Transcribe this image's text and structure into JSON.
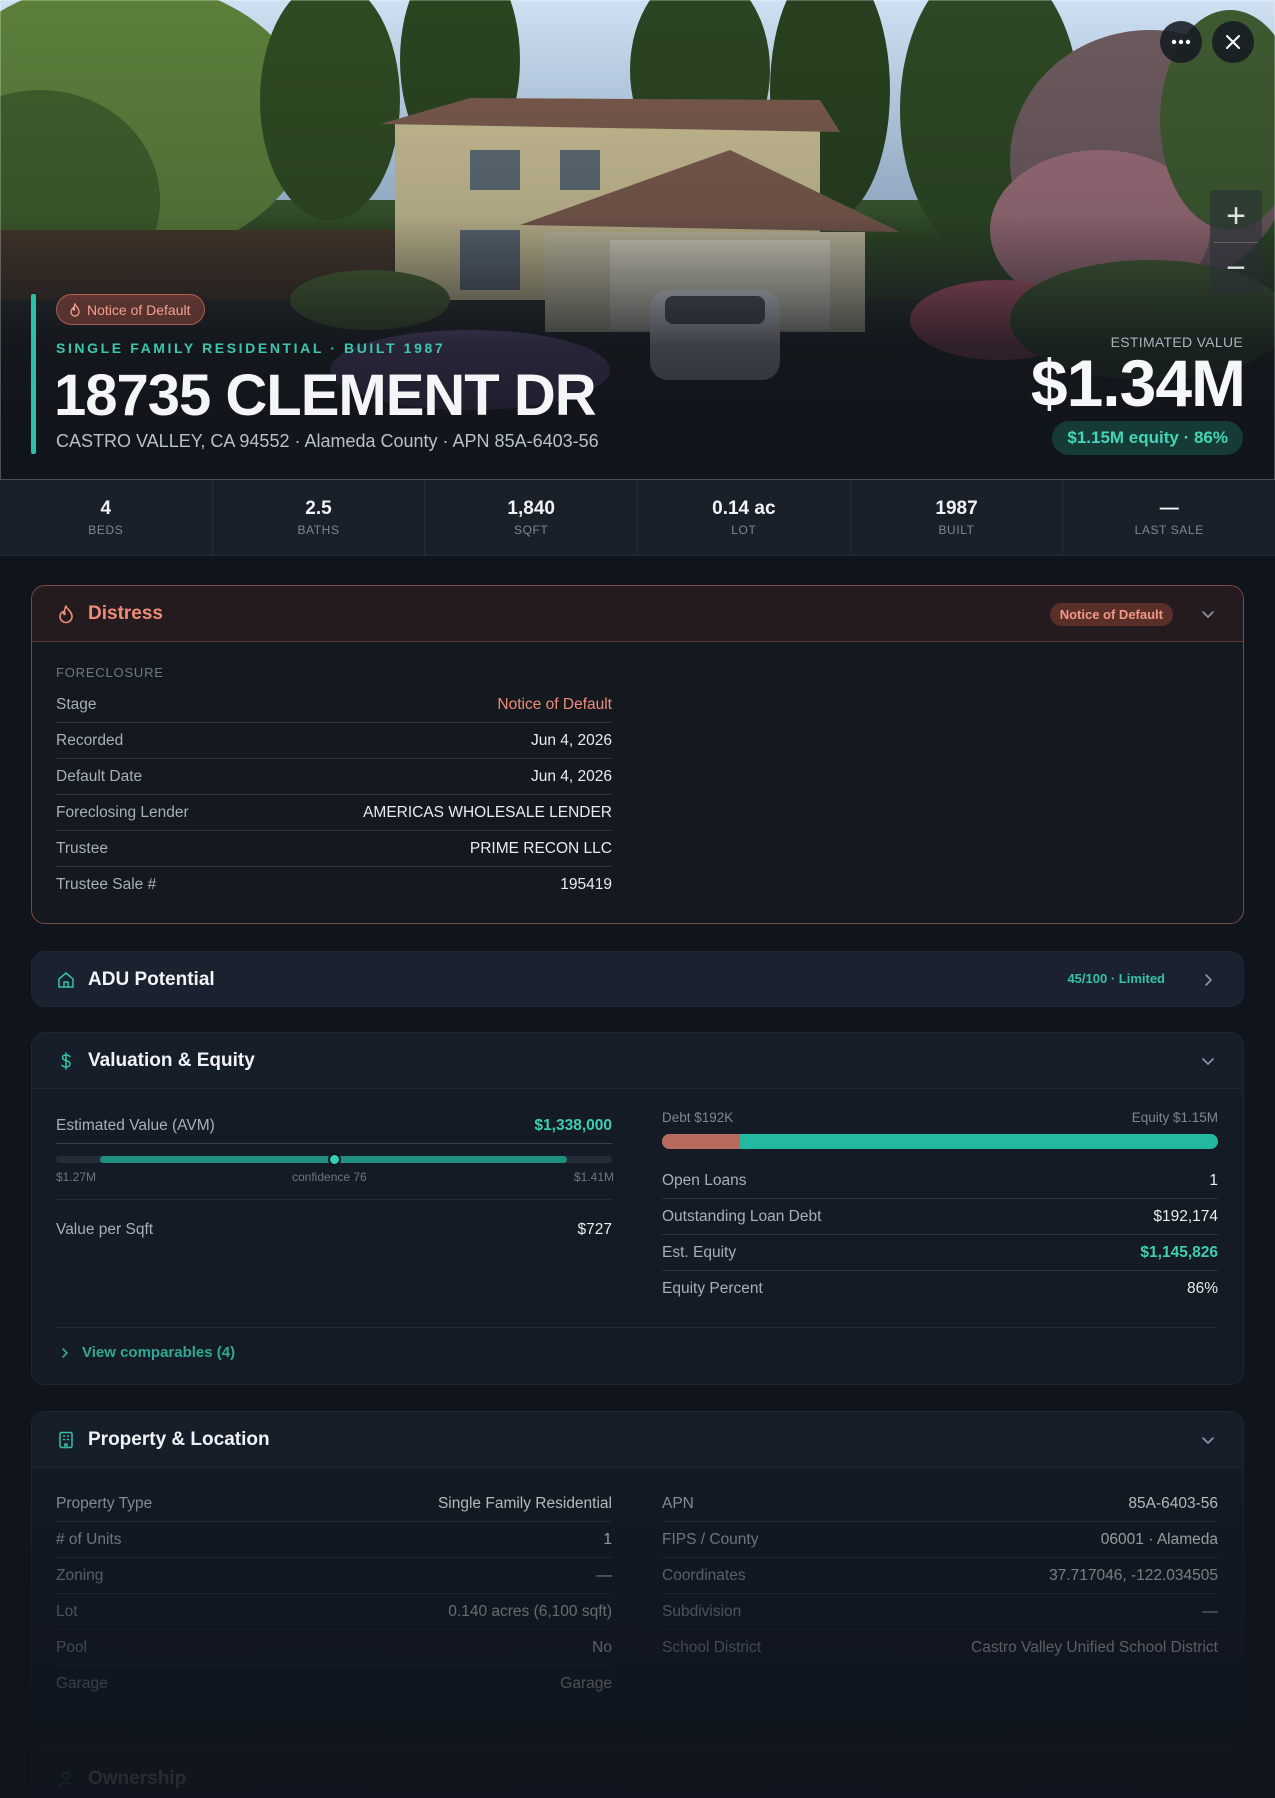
{
  "hero": {
    "distress_badge": "Notice of Default",
    "property_subtitle": "SINGLE FAMILY RESIDENTIAL · BUILT 1987",
    "address": "18735 CLEMENT DR",
    "city_line": "CASTRO VALLEY, CA 94552 · Alameda County · APN 85A-6403-56",
    "estimated_value_label": "ESTIMATED VALUE",
    "estimated_value": "$1.34M",
    "equity_badge": "$1.15M equity · 86%",
    "controls": {
      "more_icon": "more-horizontal-icon",
      "close_icon": "close-icon",
      "zoom_in": "+",
      "zoom_out": "−"
    }
  },
  "stats": [
    {
      "value": "4",
      "label": "BEDS"
    },
    {
      "value": "2.5",
      "label": "BATHS"
    },
    {
      "value": "1,840",
      "label": "SQFT"
    },
    {
      "value": "0.14 ac",
      "label": "LOT"
    },
    {
      "value": "1987",
      "label": "BUILT"
    },
    {
      "value": "—",
      "label": "LAST SALE"
    }
  ],
  "distress": {
    "title": "Distress",
    "badge": "Notice of Default",
    "section_label": "FORECLOSURE",
    "rows": [
      {
        "label": "Stage",
        "value": "Notice of Default"
      },
      {
        "label": "Recorded",
        "value": "Jun 4, 2026"
      },
      {
        "label": "Default Date",
        "value": "Jun 4, 2026"
      },
      {
        "label": "Foreclosing Lender",
        "value": "AMERICAS WHOLESALE LENDER"
      },
      {
        "label": "Trustee",
        "value": "PRIME RECON LLC"
      },
      {
        "label": "Trustee Sale #",
        "value": "195419"
      }
    ]
  },
  "adu": {
    "title": "ADU Potential",
    "score": "45/100 · Limited"
  },
  "valuation": {
    "title": "Valuation & Equity",
    "avm_label": "Estimated Value (AVM)",
    "avm_value": "$1,338,000",
    "range_low": "$1.27M",
    "range_high": "$1.41M",
    "confidence_label": "confidence 76",
    "estimate_position": 0.5,
    "value_per_sqft_label": "Value per Sqft",
    "value_per_sqft": "$727",
    "debt_label": "Debt $192K",
    "equity_label": "Equity $1.15M",
    "debt_fraction": 0.14,
    "rows": [
      {
        "label": "Open Loans",
        "value": "1"
      },
      {
        "label": "Outstanding Loan Debt",
        "value": "$192,174"
      },
      {
        "label": "Est. Equity",
        "value": "$1,145,826"
      },
      {
        "label": "Equity Percent",
        "value": "86%"
      }
    ],
    "comparables_link": "View comparables (4)"
  },
  "property": {
    "title": "Property & Location",
    "left": [
      {
        "label": "Property Type",
        "value": "Single Family Residential"
      },
      {
        "label": "# of Units",
        "value": "1"
      },
      {
        "label": "Zoning",
        "value": "—"
      },
      {
        "label": "Lot",
        "value": "0.140 acres (6,100 sqft)"
      },
      {
        "label": "Pool",
        "value": "No"
      },
      {
        "label": "Garage",
        "value": "Garage"
      }
    ],
    "right": [
      {
        "label": "APN",
        "value": "85A-6403-56"
      },
      {
        "label": "FIPS / County",
        "value": "06001 · Alameda"
      },
      {
        "label": "Coordinates",
        "value": "37.717046, -122.034505"
      },
      {
        "label": "Subdivision",
        "value": "—"
      },
      {
        "label": "School District",
        "value": "Castro Valley Unified School District"
      }
    ]
  },
  "ownership": {
    "title": "Ownership"
  },
  "colors": {
    "accent": "#2bc0a8",
    "distress": "#ef8c78",
    "debt": "#b86a5f",
    "background": "#0f141d"
  }
}
